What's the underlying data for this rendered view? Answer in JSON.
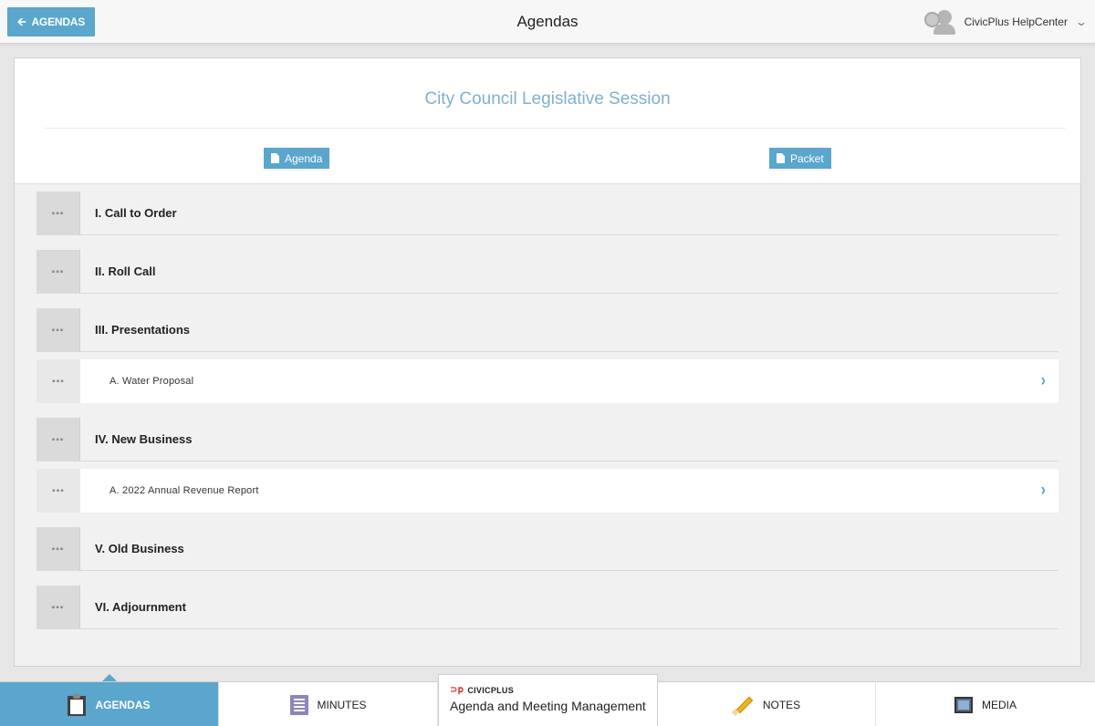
{
  "topbar": {
    "back_label": "AGENDAS",
    "title": "Agendas",
    "user_name": "CivicPlus HelpCenter"
  },
  "meeting": {
    "title": "City Council Legislative Session",
    "buttons": {
      "agenda": "Agenda",
      "packet": "Packet"
    }
  },
  "items": [
    {
      "label": "I. Call to Order",
      "level": "top"
    },
    {
      "label": "II. Roll Call",
      "level": "top"
    },
    {
      "label": "III. Presentations",
      "level": "top"
    },
    {
      "label": "A. Water Proposal",
      "level": "sub"
    },
    {
      "label": "IV. New Business",
      "level": "top"
    },
    {
      "label": "A. 2022 Annual Revenue Report",
      "level": "sub"
    },
    {
      "label": "V. Old Business",
      "level": "top"
    },
    {
      "label": "VI. Adjournment",
      "level": "top"
    }
  ],
  "bottomnav": {
    "agendas": "AGENDAS",
    "minutes": "MINUTES",
    "brand_logo": "CIVICPLUS",
    "brand_name": "Agenda and Meeting Management",
    "notes": "NOTES",
    "media": "MEDIA"
  },
  "colors": {
    "accent": "#5aa6cd",
    "title_blue": "#7fb0cf"
  }
}
